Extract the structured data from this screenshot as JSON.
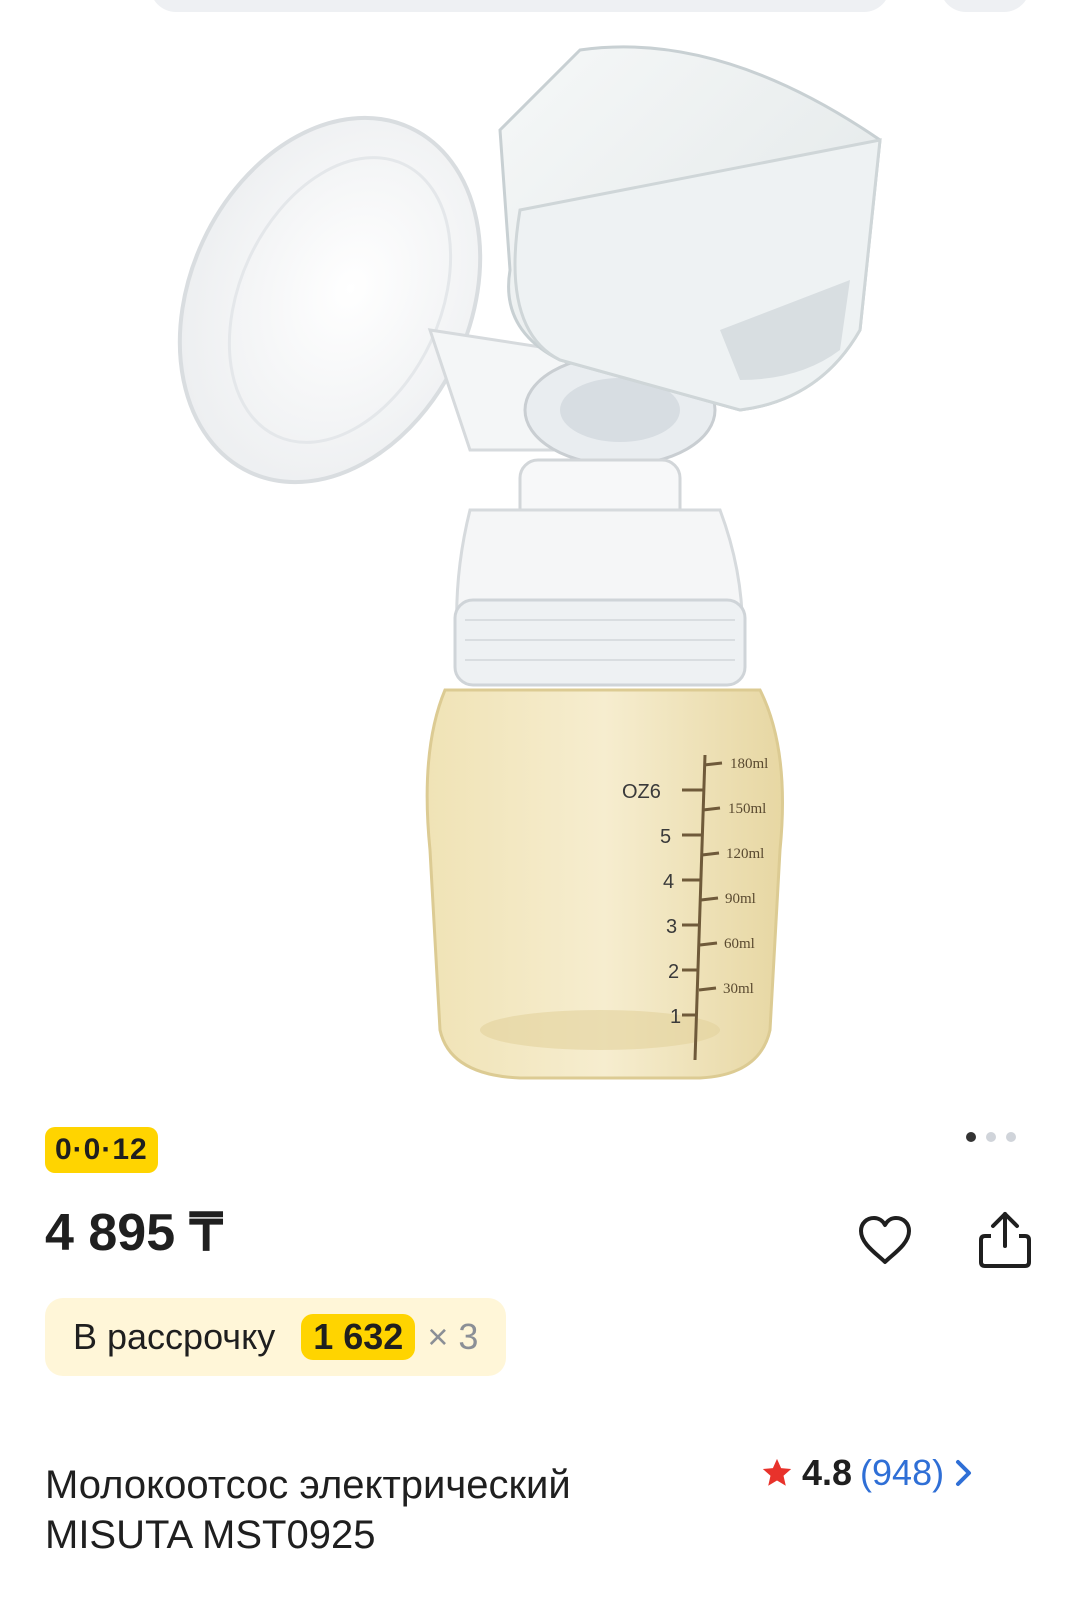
{
  "product": {
    "image": {
      "alt": "Молокоотсос электрический MISUTA MST0925",
      "bottle_marks_oz": [
        "OZ6",
        "5",
        "4",
        "3",
        "2",
        "1"
      ],
      "bottle_marks_ml": [
        "180ml",
        "150ml",
        "120ml",
        "90ml",
        "60ml",
        "30ml"
      ]
    },
    "installment_badge": "0·0·12",
    "gallery": {
      "total": 3,
      "active": 1
    },
    "price": "4 895 ₸",
    "installment": {
      "label": "В рассрочку",
      "amount": "1 632",
      "multiplier": "× 3"
    },
    "title_line1": "Молокоотсос электрический",
    "title_line2": "MISUTA MST0925",
    "rating": {
      "value": "4.8",
      "count": "(948)"
    }
  },
  "icons": [
    "heart-icon",
    "share-icon",
    "star-icon",
    "chevron-right-icon"
  ],
  "colors": {
    "accent_yellow": "#ffd400",
    "installment_bg": "#fff6d8",
    "rating_star": "#e8322b",
    "link_blue": "#2f6fd6"
  }
}
